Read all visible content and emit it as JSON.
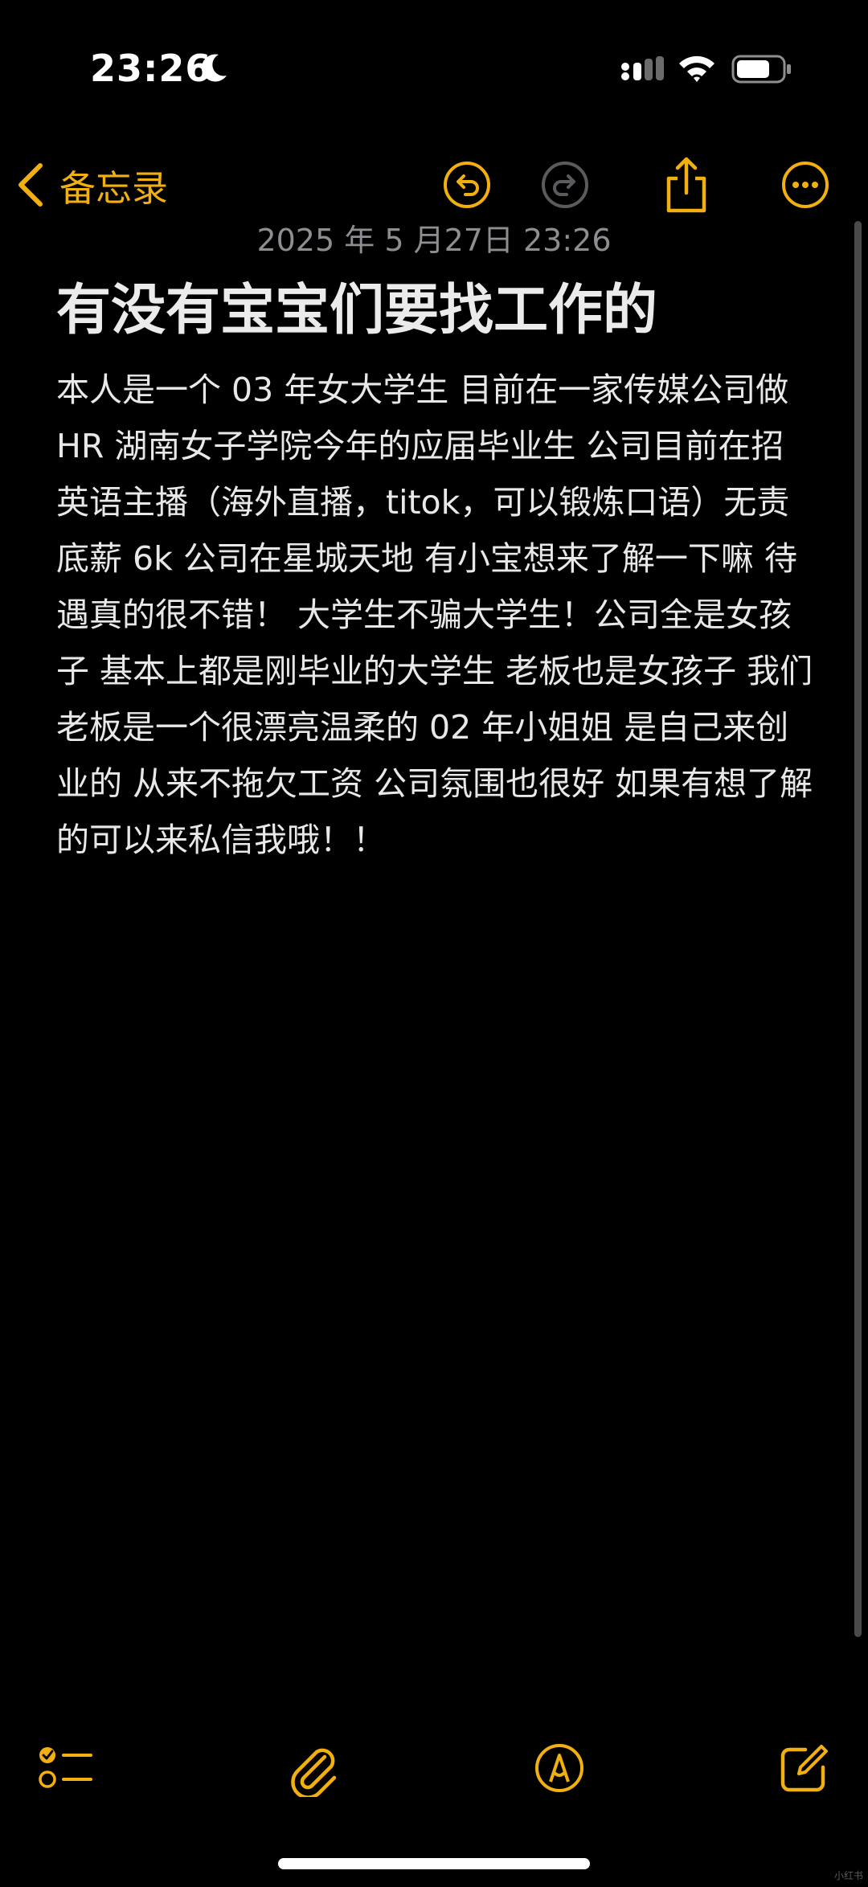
{
  "status_bar": {
    "time": "23:26",
    "focus_icon": "moon-icon",
    "signal_icon": "cellular-signal-icon",
    "wifi_icon": "wifi-icon",
    "battery_icon": "battery-icon"
  },
  "nav": {
    "back_label": "备忘录",
    "back_icon": "chevron-left-icon",
    "undo_icon": "undo-icon",
    "redo_icon": "redo-icon",
    "share_icon": "share-icon",
    "more_icon": "ellipsis-icon"
  },
  "note": {
    "timestamp": "2025 年 5 月27日 23:26",
    "title": "有没有宝宝们要找工作的",
    "body": "本人是一个 03 年女大学生 目前在一家传媒公司做 HR 湖南女子学院今年的应届毕业生 公司目前在招英语主播（海外直播，titok，可以锻炼口语）无责底薪 6k 公司在星城天地 有小宝想来了解一下嘛 待遇真的很不错！ 大学生不骗大学生！公司全是女孩子 基本上都是刚毕业的大学生 老板也是女孩子 我们老板是一个很漂亮温柔的 02 年小姐姐 是自己来创业的 从来不拖欠工资 公司氛围也很好 如果有想了解的可以来私信我哦！！"
  },
  "toolbar": {
    "checklist_icon": "checklist-icon",
    "attachment_icon": "paperclip-icon",
    "markup_icon": "markup-pen-icon",
    "compose_icon": "compose-icon"
  },
  "watermark": "小红书",
  "colors": {
    "accent": "#f1b00f",
    "background": "#000000",
    "text": "#e8e8e8",
    "timestamp": "#8d8d92",
    "disabled": "#5b5b5f"
  }
}
